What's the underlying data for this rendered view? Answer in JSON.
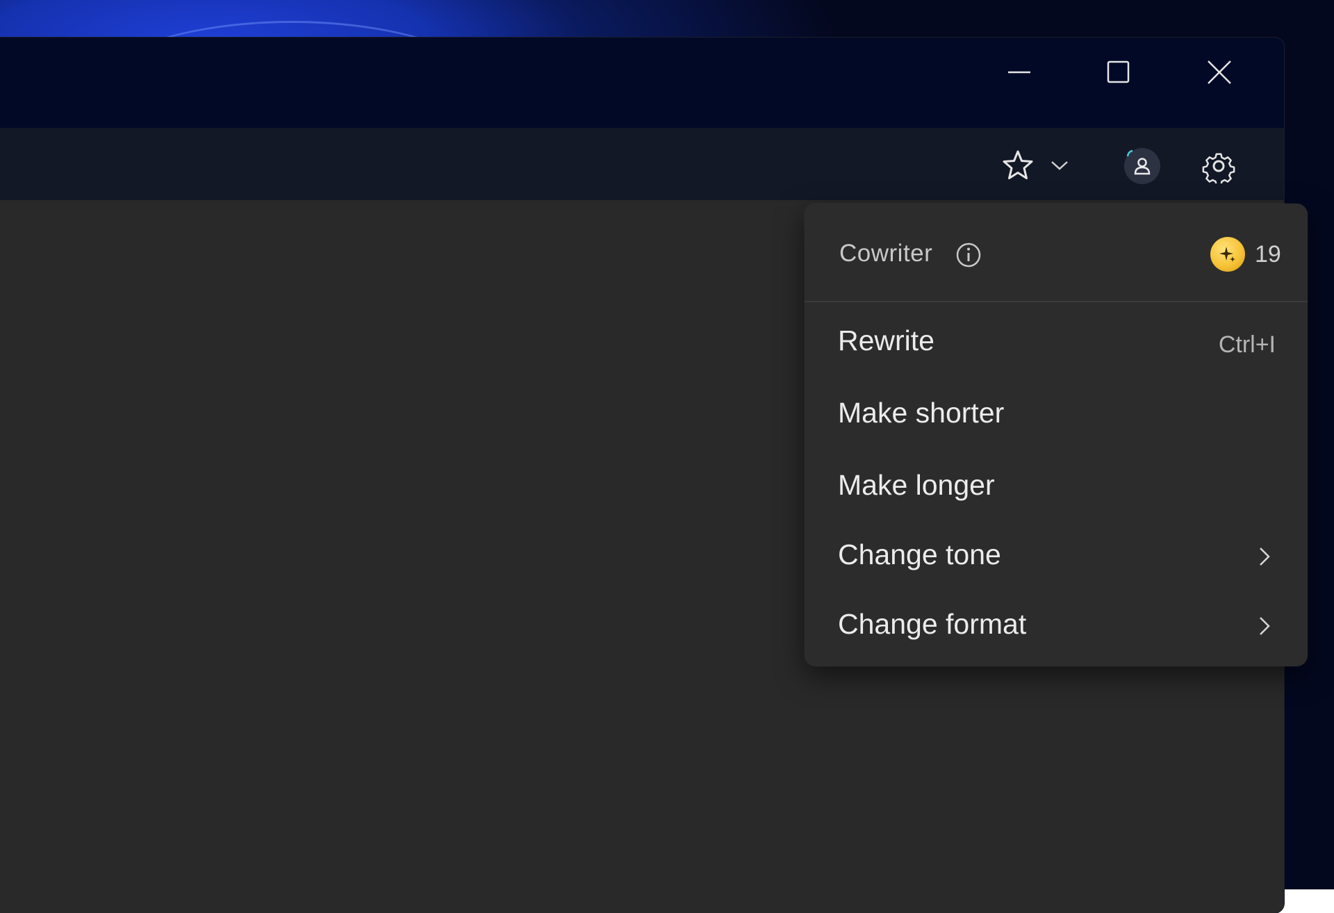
{
  "colors": {
    "desktop_accent": "#1f3fd6",
    "titlebar_bg": "#020926",
    "toolbar_bg": "#131826",
    "content_bg": "#292929",
    "menu_bg": "#2c2c2c",
    "coin": "#f6c337"
  },
  "window_controls": {
    "minimize_icon": "minimize-icon",
    "maximize_icon": "maximize-icon",
    "close_icon": "close-icon"
  },
  "toolbar": {
    "icons": [
      "star-icon",
      "chevron-down-icon",
      "profile-icon",
      "gear-icon"
    ]
  },
  "cowriter_menu": {
    "title": "Cowriter",
    "info_icon": "info-icon",
    "credits": "19",
    "credit_icon": "sparkle-coin-icon",
    "items": [
      {
        "label": "Rewrite",
        "shortcut": "Ctrl+I",
        "submenu": false
      },
      {
        "label": "Make shorter",
        "shortcut": "",
        "submenu": false
      },
      {
        "label": "Make longer",
        "shortcut": "",
        "submenu": false
      },
      {
        "label": "Change tone",
        "shortcut": "",
        "submenu": true
      },
      {
        "label": "Change format",
        "shortcut": "",
        "submenu": true
      }
    ]
  }
}
